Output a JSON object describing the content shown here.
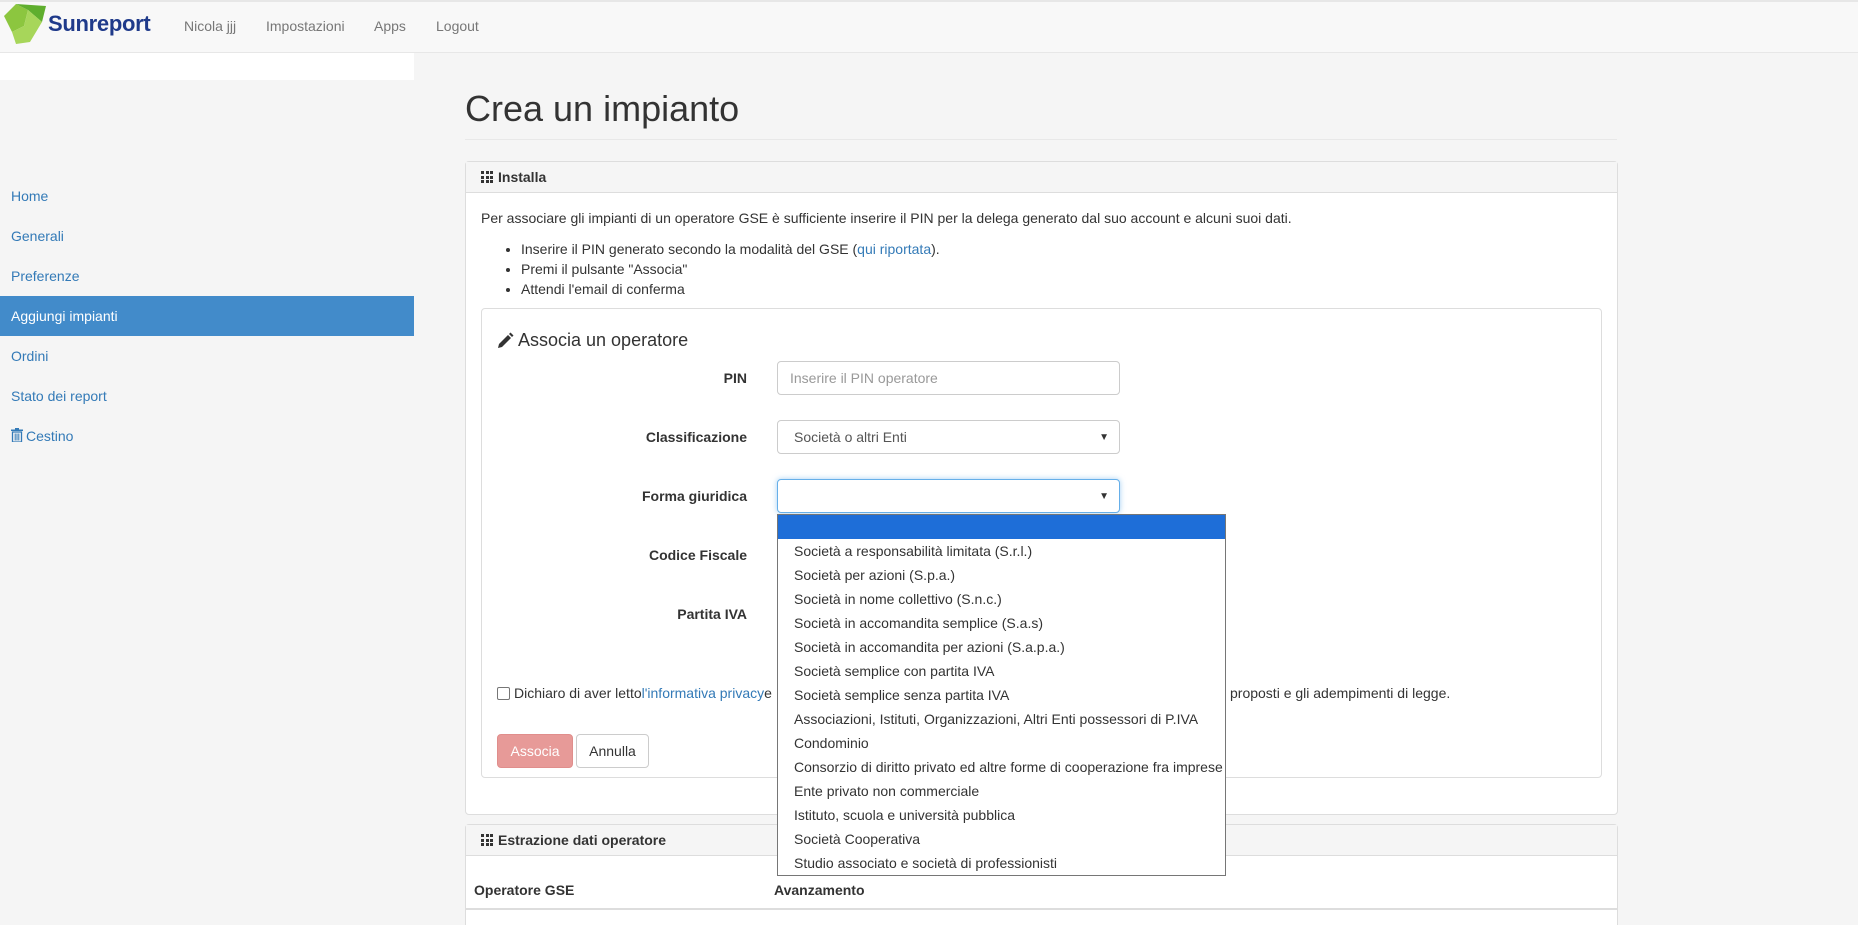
{
  "navbar": {
    "brand": "Sunreport",
    "links": [
      "Nicola jjj",
      "Impostazioni",
      "Apps",
      "Logout"
    ]
  },
  "sidebar": {
    "items": [
      {
        "label": "Home",
        "active": false
      },
      {
        "label": "Generali",
        "active": false
      },
      {
        "label": "Preferenze",
        "active": false
      },
      {
        "label": "Aggiungi impianti",
        "active": true
      },
      {
        "label": "Ordini",
        "active": false
      },
      {
        "label": "Stato dei report",
        "active": false
      },
      {
        "label": "Cestino",
        "active": false,
        "icon": "trash-icon"
      }
    ]
  },
  "page": {
    "title": "Crea un impianto"
  },
  "install_panel": {
    "heading": "Installa",
    "intro": "Per associare gli impianti di un operatore GSE è sufficiente inserire il PIN per la delega generato dal suo account e alcuni suoi dati.",
    "bullet1_prefix": "Inserire il PIN generato secondo la modalità del GSE (",
    "bullet1_link": "qui riportata",
    "bullet1_suffix": ").",
    "bullet2": "Premi il pulsante \"Associa\"",
    "bullet3": "Attendi l'email di conferma"
  },
  "form": {
    "title": "Associa un operatore",
    "pin_label": "PIN",
    "pin_placeholder": "Inserire il PIN operatore",
    "classification_label": "Classificazione",
    "classification_value": "Società o altri Enti",
    "legal_form_label": "Forma giuridica",
    "legal_form_value": "",
    "tax_code_label": "Codice Fiscale",
    "vat_label": "Partita IVA",
    "privacy_prefix": "Dichiaro di aver letto ",
    "privacy_link": "l'informativa privacy",
    "privacy_middle": " e",
    "privacy_tail": "proposti e gli adempimenti di legge.",
    "associate_button": "Associa",
    "cancel_button": "Annulla"
  },
  "dropdown": {
    "options": [
      "",
      "Società a responsabilità limitata (S.r.l.)",
      "Società per azioni (S.p.a.)",
      "Società in nome collettivo (S.n.c.)",
      "Società in accomandita semplice (S.a.s)",
      "Società in accomandita per azioni (S.a.p.a.)",
      "Società semplice con partita IVA",
      "Società semplice senza partita IVA",
      "Associazioni, Istituti, Organizzazioni, Altri Enti possessori di P.IVA",
      "Condominio",
      "Consorzio di diritto privato ed altre forme di cooperazione fra imprese",
      "Ente privato non commerciale",
      "Istituto, scuola e università pubblica",
      "Società Cooperativa",
      "Studio associato e società di professionisti"
    ],
    "selected_index": 0
  },
  "extraction_panel": {
    "heading": "Estrazione dati operatore",
    "columns": [
      "Operatore GSE",
      "Avanzamento"
    ]
  },
  "colors": {
    "accent": "#428bca",
    "link": "#337ab7",
    "associate_button": "#e79a98",
    "dropdown_selected": "#1e6ed8"
  }
}
